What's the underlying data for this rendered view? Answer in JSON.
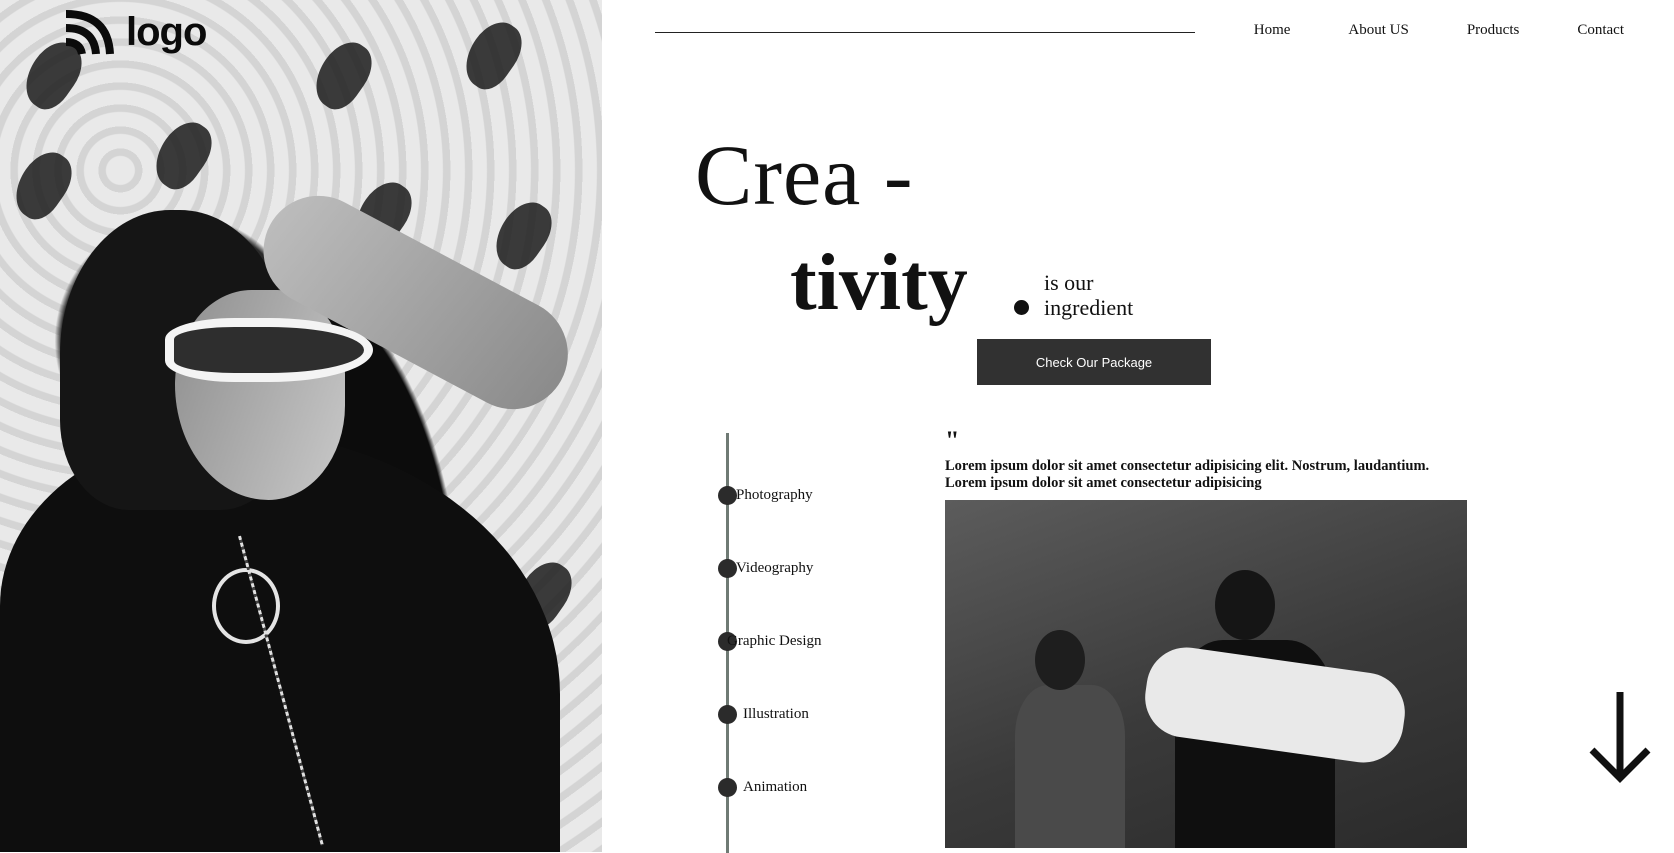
{
  "logo": {
    "text": "logo",
    "icon": "logo-mark-icon"
  },
  "nav": {
    "items": [
      "Home",
      "About US",
      "Products",
      "Contact"
    ]
  },
  "hero": {
    "line1": "Crea -",
    "line2": "tivity",
    "subtitle_line1": "is our",
    "subtitle_line2": "ingredient",
    "cta_label": "Check Our Package"
  },
  "services": [
    "Photography",
    "Videography",
    "Graphic Design",
    "Illustration",
    "Animation"
  ],
  "quote": {
    "mark": "\"",
    "line1": "Lorem ipsum dolor sit amet consectetur adipisicing elit. Nostrum, laudantium.",
    "line2": "Lorem ipsum dolor sit amet consectetur adipisicing"
  },
  "icons": {
    "scroll": "arrow-down-icon"
  },
  "colors": {
    "button_bg": "#313131",
    "timeline": "#6f7a74",
    "text": "#111111"
  }
}
